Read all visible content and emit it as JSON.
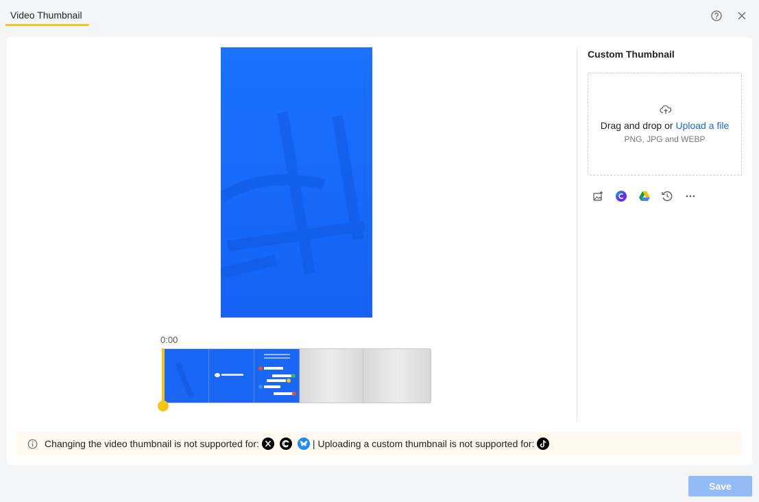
{
  "header": {
    "title": "Video Thumbnail"
  },
  "timeline": {
    "time": "0:00"
  },
  "custom_thumbnail": {
    "title": "Custom Thumbnail",
    "drag_text": "Drag and drop or ",
    "upload_link": "Upload a file",
    "formats": "PNG, JPG and WEBP"
  },
  "notice": {
    "text1": "Changing the video thumbnail is not supported for:",
    "separator": "|",
    "text2": "Uploading a custom thumbnail is not supported for:"
  },
  "footer": {
    "save_label": "Save"
  }
}
